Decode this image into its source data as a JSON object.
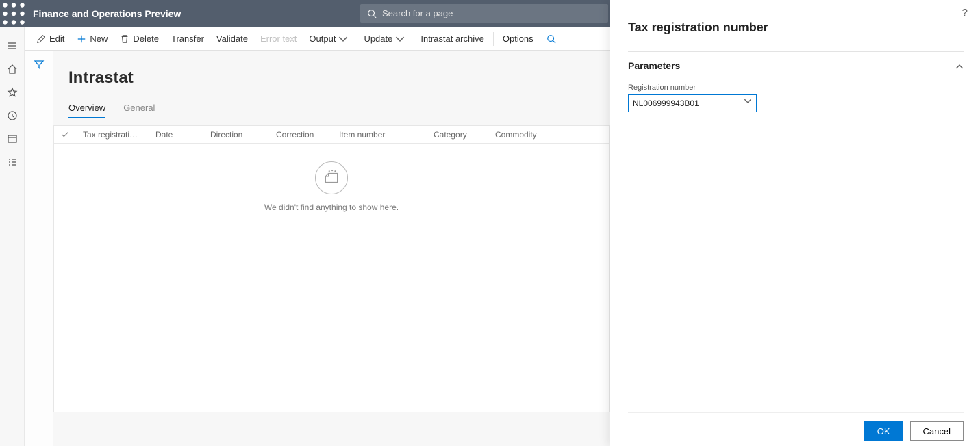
{
  "app_title": "Finance and Operations Preview",
  "search_placeholder": "Search for a page",
  "actions": {
    "edit": "Edit",
    "new": "New",
    "delete": "Delete",
    "transfer": "Transfer",
    "validate": "Validate",
    "error_text": "Error text",
    "output": "Output",
    "update": "Update",
    "intrastat_archive": "Intrastat archive",
    "options": "Options"
  },
  "page_title": "Intrastat",
  "tabs": {
    "overview": "Overview",
    "general": "General"
  },
  "grid_columns": [
    "Tax registration num...",
    "Date",
    "Direction",
    "Correction",
    "Item number",
    "Category",
    "Commodity"
  ],
  "grid_empty_message": "We didn't find anything to show here.",
  "panel": {
    "title": "Tax registration number",
    "section_title": "Parameters",
    "field_label": "Registration number",
    "field_value": "NL006999943B01",
    "ok": "OK",
    "cancel": "Cancel"
  }
}
